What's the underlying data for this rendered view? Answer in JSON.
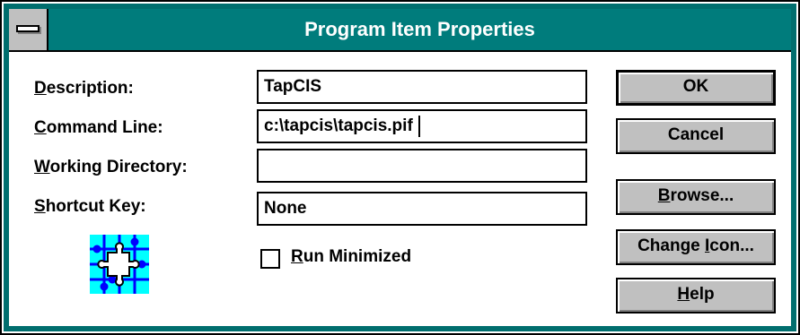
{
  "window": {
    "title": "Program Item Properties"
  },
  "fields": [
    {
      "label_pre": "",
      "label_ul": "D",
      "label_post": "escription:",
      "value": "TapCIS"
    },
    {
      "label_pre": "",
      "label_ul": "C",
      "label_post": "ommand Line:",
      "value": "c:\\tapcis\\tapcis.pif"
    },
    {
      "label_pre": "",
      "label_ul": "W",
      "label_post": "orking Directory:",
      "value": ""
    },
    {
      "label_pre": "",
      "label_ul": "S",
      "label_post": "hortcut Key:",
      "value": "None"
    }
  ],
  "checkbox": {
    "label_ul": "R",
    "label_post": "un Minimized",
    "checked": false
  },
  "buttons": {
    "ok": {
      "pre": "OK",
      "ul": "",
      "post": ""
    },
    "cancel": {
      "pre": "Cancel",
      "ul": "",
      "post": ""
    },
    "browse": {
      "pre": "",
      "ul": "B",
      "post": "rowse..."
    },
    "change_icon": {
      "pre": "Change ",
      "ul": "I",
      "post": "con..."
    },
    "help": {
      "pre": "",
      "ul": "H",
      "post": "elp"
    }
  },
  "icon": {
    "name": "puzzle-piece-icon",
    "colors": {
      "background": "#00ffff",
      "grid": "#0000ff",
      "piece": "#ffffff"
    }
  },
  "colors": {
    "titlebar": "#007c7c",
    "frame": "#006e6e",
    "button_face": "#c0c0c0"
  }
}
